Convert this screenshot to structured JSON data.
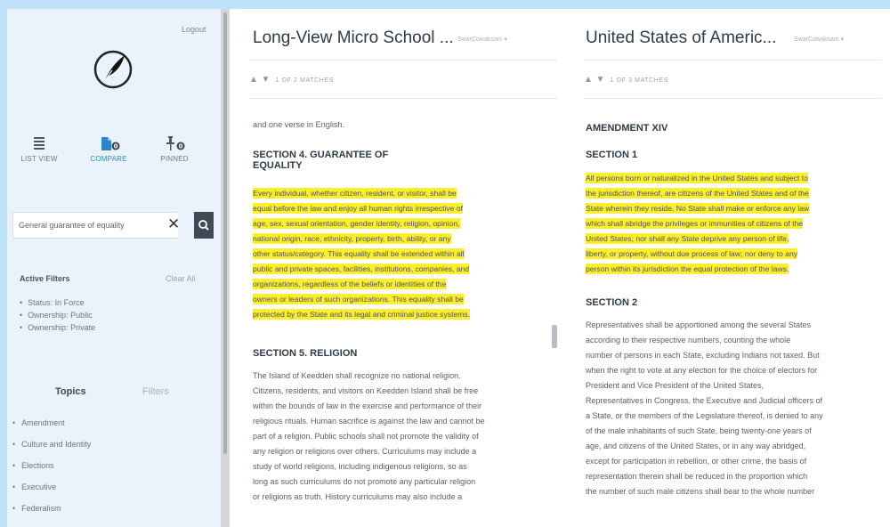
{
  "sidebar": {
    "logout": "Logout",
    "views": [
      {
        "label": "LIST VIEW",
        "icon": "list-icon"
      },
      {
        "label": "COMPARE",
        "icon": "compare-icon"
      },
      {
        "label": "PINNED",
        "icon": "pin-icon"
      }
    ],
    "search": {
      "value": "General guarantee of equality"
    },
    "active_filters": {
      "title": "Active Filters",
      "clear_all": "Clear All",
      "items": [
        "Status: In Force",
        "Ownership: Public",
        "Ownership: Private"
      ]
    },
    "tabs": {
      "topics": "Topics",
      "filters": "Filters"
    },
    "topics": [
      "Amendment",
      "Culture and Identity",
      "Elections",
      "Executive",
      "Federalism"
    ]
  },
  "colors": {
    "highlight": "#fbef2d",
    "accent": "#2a86c7",
    "sidebar_bg": "#eaf3fb"
  },
  "pane1": {
    "title": "Long-View Micro School ...",
    "select": "SwarCowaksam",
    "matches": "1 OF 2 MATCHES",
    "intro": "and one verse in English.",
    "section4_heading_line1": "SECTION 4. GUARANTEE OF",
    "section4_heading_line2": "EQUALITY",
    "section4_lines": [
      "Every individual, whether citizen, resident, or visitor, shall be",
      "equal before the law and enjoy all human rights irrespective of",
      "age, sex, sexual orientation, gender identity, religion, opinion,",
      "national origin, race, ethnicity, property, birth, ability, or any",
      "other status/category. This equality shall be extended within all",
      "public and private spaces, facilities, institutions, companies, and",
      "organizations, regardless of the beliefs or identities of the",
      "owners or leaders of such organizations. This equality shall be",
      "protected by the State and its legal and criminal justice systems."
    ],
    "section5_heading": "SECTION 5. RELIGION",
    "section5_lines": [
      "The Island of Keedden shall recognize no national religion.",
      "Citizens, residents, and visitors on Keedden Island shall be free",
      "within the bounds of law in the exercise and performance of their",
      "religious rituals. Human sacrifice is against the law and cannot be",
      "part of a religion. Public schools shall not promote the validity of",
      "any religion or religions over others. Curriculums may include a",
      "study of world religions, including indigenous religions, so as",
      "long as such curriculums do not promote any particular religion",
      "or religions as truth. History curriculums may also include a"
    ]
  },
  "pane2": {
    "title": "United States of Americ...",
    "select": "SwarCowaksam",
    "matches": "1 OF 3 MATCHES",
    "amendment_heading": "AMENDMENT XIV",
    "section1_heading": "SECTION 1",
    "section1_lines": [
      "All persons born or naturalized in the United States and subject to",
      "the jurisdiction thereof, are citizens of the United States and of the",
      "State wherein they reside. No State shall make or enforce any law",
      "which shall abridge the privileges or immunities of citizens of the",
      "United States; nor shall any State deprive any person of life,",
      "liberty, or property, without due process of law; nor deny to any",
      "person within its jurisdiction the equal protection of the laws."
    ],
    "section2_heading": "SECTION 2",
    "section2_lines": [
      "Representatives shall be apportioned among the several States",
      "according to their respective numbers, counting the whole",
      "number of persons in each State, excluding Indians not taxed. But",
      "when the right to vote at any election for the choice of electors for",
      "President and Vice President of the United States,",
      "Representatives in Congress, the Executive and Judicial officers of",
      "a State, or the members of the Legislature thereof, is denied to any",
      "of the male inhabitants of such State, being twenty-one years of",
      "age, and citizens of the United States, or in any way abridged,",
      "except for participation in rebellion, or other crime, the basis of",
      "representation therein shall be reduced in the proportion which",
      "the number of such male citizens shall bear to the whole number"
    ]
  }
}
